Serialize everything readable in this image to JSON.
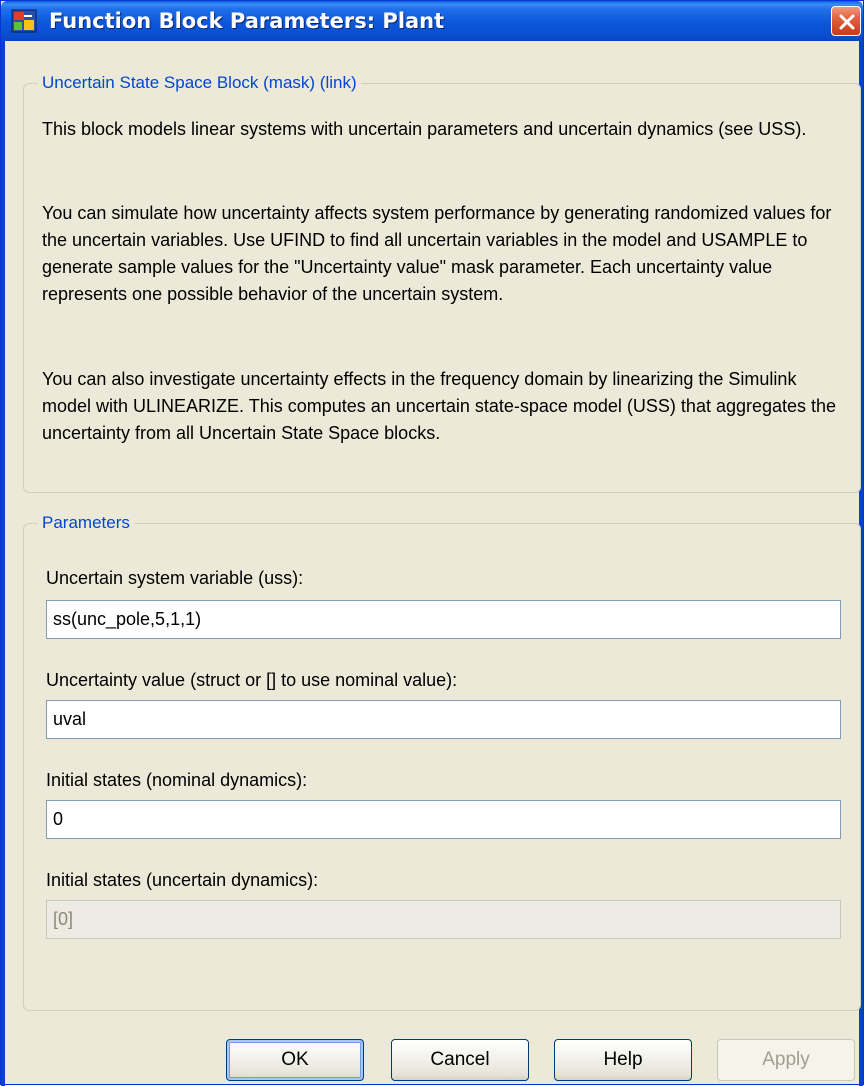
{
  "window": {
    "title": "Function Block Parameters: Plant"
  },
  "description": {
    "legend": "Uncertain State Space Block (mask) (link)",
    "paragraphs": [
      "This block models linear systems with uncertain parameters and uncertain dynamics (see USS).",
      "You can simulate how uncertainty affects system performance by generating randomized values for the uncertain variables. Use UFIND to find all uncertain variables in the model and USAMPLE to generate sample values for the \"Uncertainty value\" mask parameter. Each uncertainty value represents one possible behavior of the uncertain system.",
      "You can also investigate uncertainty effects in the frequency domain by linearizing the Simulink model with ULINEARIZE. This computes an uncertain state-space model (USS) that aggregates the uncertainty from all Uncertain State Space blocks."
    ]
  },
  "parameters": {
    "legend": "Parameters",
    "fields": [
      {
        "label": "Uncertain system variable (uss):",
        "value": "ss(unc_pole,5,1,1)"
      },
      {
        "label": "Uncertainty value (struct or [] to use nominal value):",
        "value": "uval"
      },
      {
        "label": "Initial states (nominal dynamics):",
        "value": "0"
      },
      {
        "label": "Initial states (uncertain dynamics):",
        "value": "[0]"
      }
    ]
  },
  "buttons": {
    "ok": "OK",
    "cancel": "Cancel",
    "help": "Help",
    "apply": "Apply"
  },
  "icons": {
    "window_icon": "simulink-block-icon",
    "close": "close-icon"
  },
  "colors": {
    "titlebar": "#0A4FCF",
    "legend_text": "#0046D5",
    "dialog_bg": "#ECE9D8",
    "close_button": "#D5481F"
  }
}
